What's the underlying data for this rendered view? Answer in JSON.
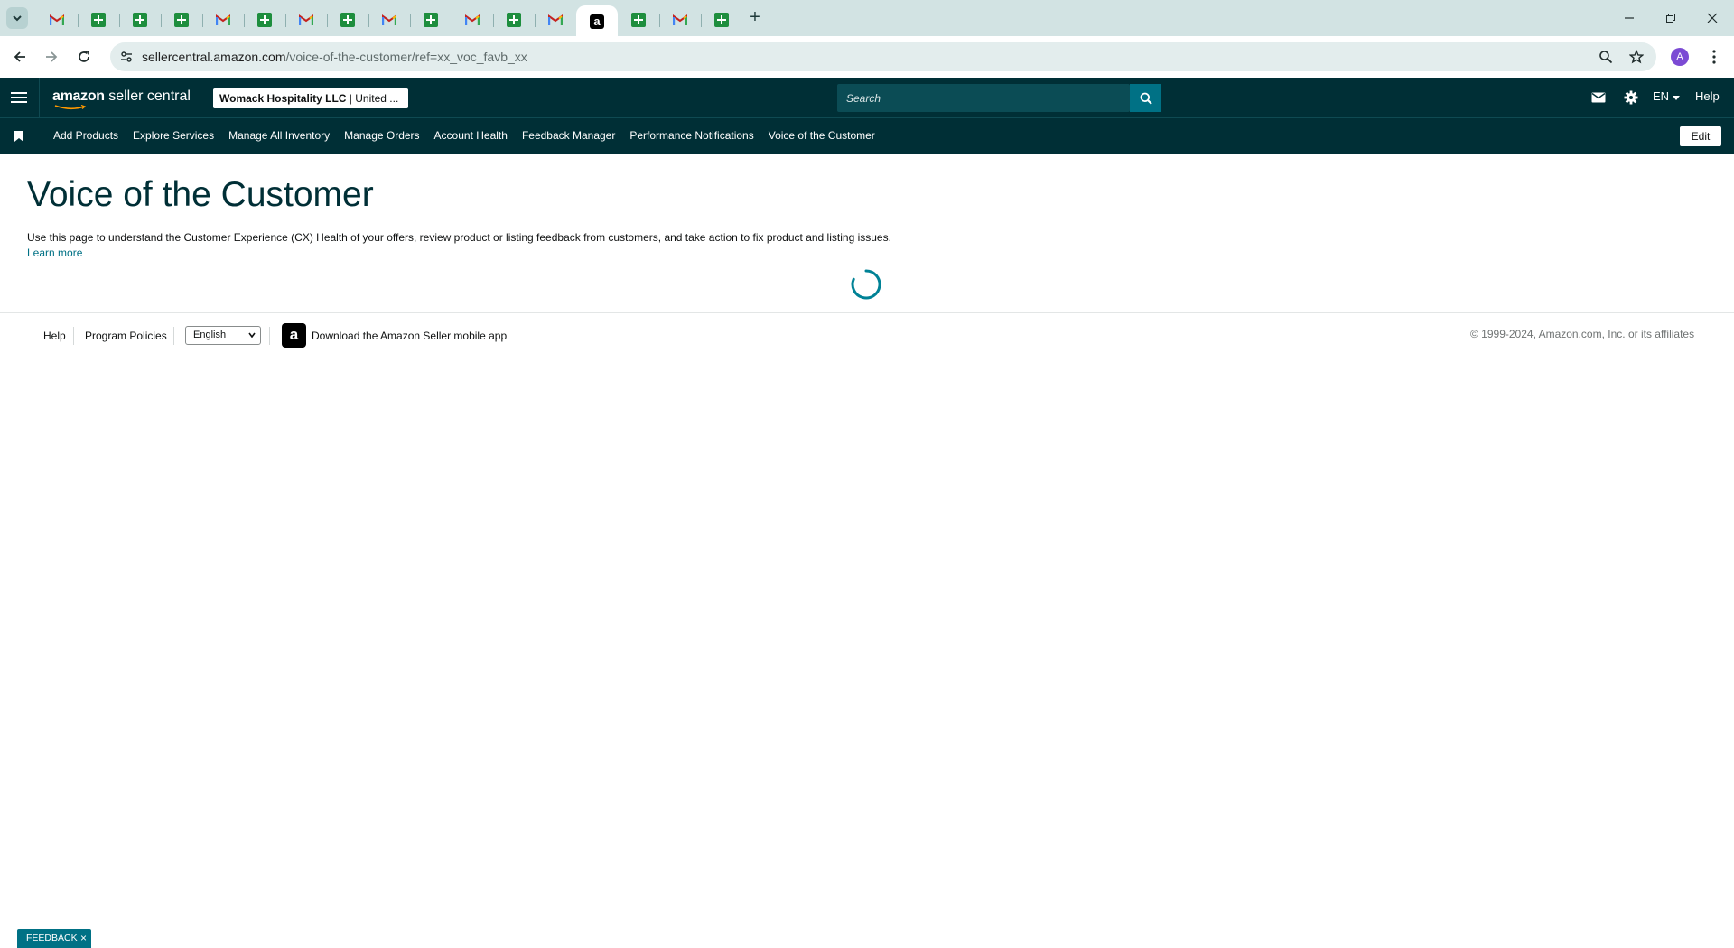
{
  "browser": {
    "tabs": [
      {
        "type": "gmail"
      },
      {
        "type": "sheets"
      },
      {
        "type": "sheets"
      },
      {
        "type": "sheets"
      },
      {
        "type": "gmail"
      },
      {
        "type": "sheets"
      },
      {
        "type": "gmail"
      },
      {
        "type": "sheets"
      },
      {
        "type": "gmail"
      },
      {
        "type": "sheets"
      },
      {
        "type": "gmail"
      },
      {
        "type": "sheets"
      },
      {
        "type": "gmail"
      },
      {
        "type": "amazon",
        "active": true
      },
      {
        "type": "sheets"
      },
      {
        "type": "gmail"
      },
      {
        "type": "sheets"
      }
    ],
    "url_host": "sellercentral.amazon.com",
    "url_path": "/voice-of-the-customer/ref=xx_voc_favb_xx",
    "profile_initial": "A",
    "amazon_favicon_letter": "a"
  },
  "header": {
    "logo_brand": "amazon",
    "logo_product": " seller central",
    "account_name": "Womack Hospitality LLC",
    "account_region": " | United ...",
    "search_placeholder": "Search",
    "language": "EN",
    "help": "Help"
  },
  "nav": {
    "items": [
      "Add Products",
      "Explore Services",
      "Manage All Inventory",
      "Manage Orders",
      "Account Health",
      "Feedback Manager",
      "Performance Notifications",
      "Voice of the Customer"
    ],
    "edit_label": "Edit"
  },
  "main": {
    "title": "Voice of the Customer",
    "description": "Use this page to understand the Customer Experience (CX) Health of your offers, review product or listing feedback from customers, and take action to fix product and listing issues.",
    "learn_more": "Learn more"
  },
  "footer": {
    "help": "Help",
    "program_policies": "Program Policies",
    "language_selected": "English",
    "app_link": "Download the Amazon Seller mobile app",
    "copyright": "© 1999-2024, Amazon.com, Inc. or its affiliates"
  },
  "feedback_button": "FEEDBACK",
  "colors": {
    "header_bg": "#002f36",
    "accent": "#007185",
    "tabstrip_bg": "#d2e3e3"
  }
}
